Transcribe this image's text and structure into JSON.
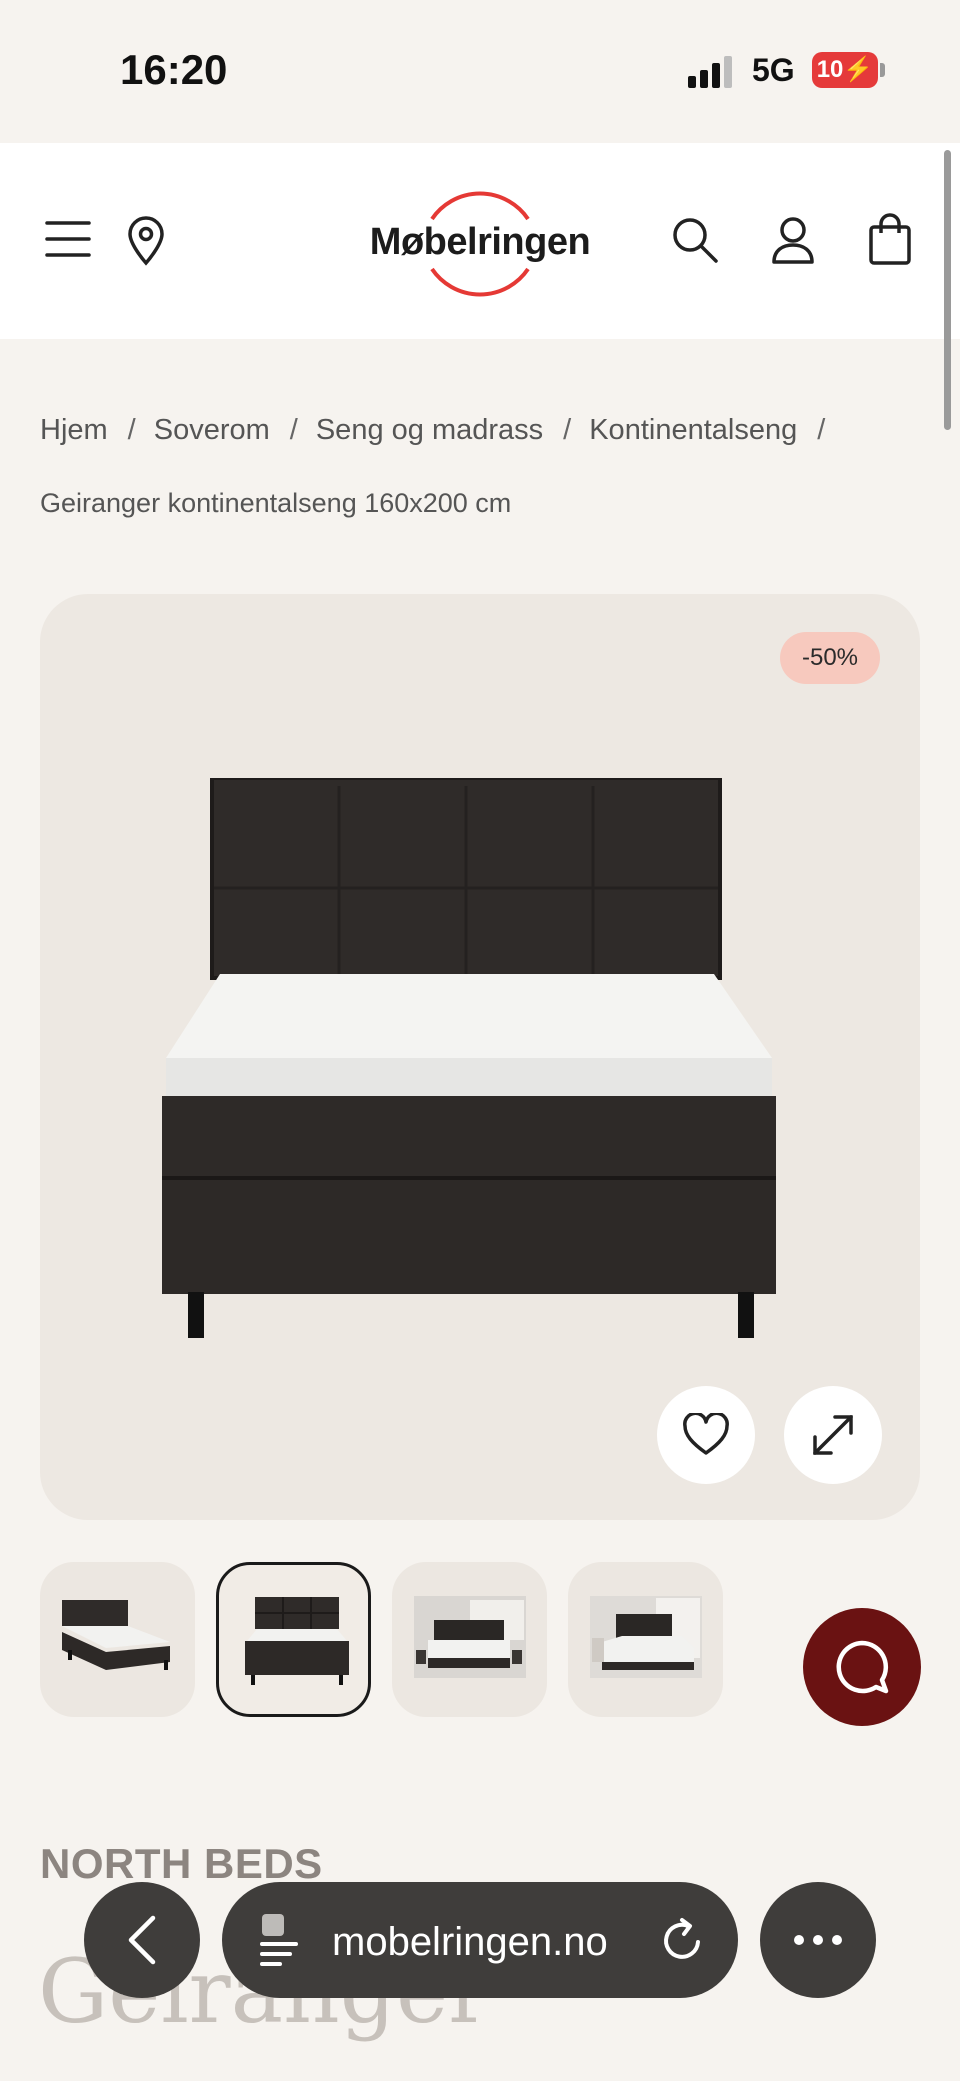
{
  "status_bar": {
    "time": "16:20",
    "network": "5G",
    "battery": "10"
  },
  "header": {
    "logo_text": "Møbelringen",
    "icons": [
      "menu-icon",
      "location-pin-icon",
      "search-icon",
      "user-icon",
      "shopping-bag-icon"
    ]
  },
  "breadcrumb": {
    "items": [
      "Hjem",
      "Soverom",
      "Seng og madrass",
      "Kontinentalseng"
    ],
    "separator": "/",
    "current": "Geiranger kontinentalseng 160x200 cm"
  },
  "gallery": {
    "discount_badge": "-50%",
    "thumbnails_count": 4,
    "active_thumbnail": 2
  },
  "product": {
    "brand": "NORTH BEDS",
    "title": "Geiranger"
  },
  "browser": {
    "url": "mobelringen.no"
  },
  "colors": {
    "background": "#f6f3ef",
    "brand_red": "#e53935",
    "chat_button": "#6a1212",
    "badge": "#f7c9be"
  }
}
